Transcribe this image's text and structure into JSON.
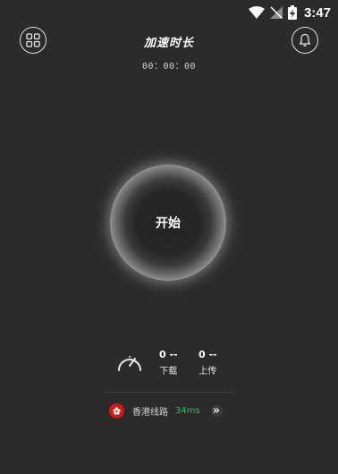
{
  "status_bar": {
    "time": "3:47"
  },
  "header": {
    "title": "加速时长",
    "timer": "00：00：00"
  },
  "main": {
    "start_label": "开始"
  },
  "stats": {
    "download": {
      "value": "0 --",
      "label": "下载"
    },
    "upload": {
      "value": "0 --",
      "label": "上传"
    }
  },
  "route": {
    "name": "香港线路",
    "latency": "34ms"
  },
  "colors": {
    "background": "#2b2b2b",
    "latency": "#3fb85a",
    "flag": "#d8141b"
  },
  "icons": {
    "menu": "grid-icon",
    "notifications": "bell-icon",
    "speed": "speedometer-icon",
    "region": "hong-kong-flag-icon",
    "more": "double-chevron-right-icon"
  }
}
